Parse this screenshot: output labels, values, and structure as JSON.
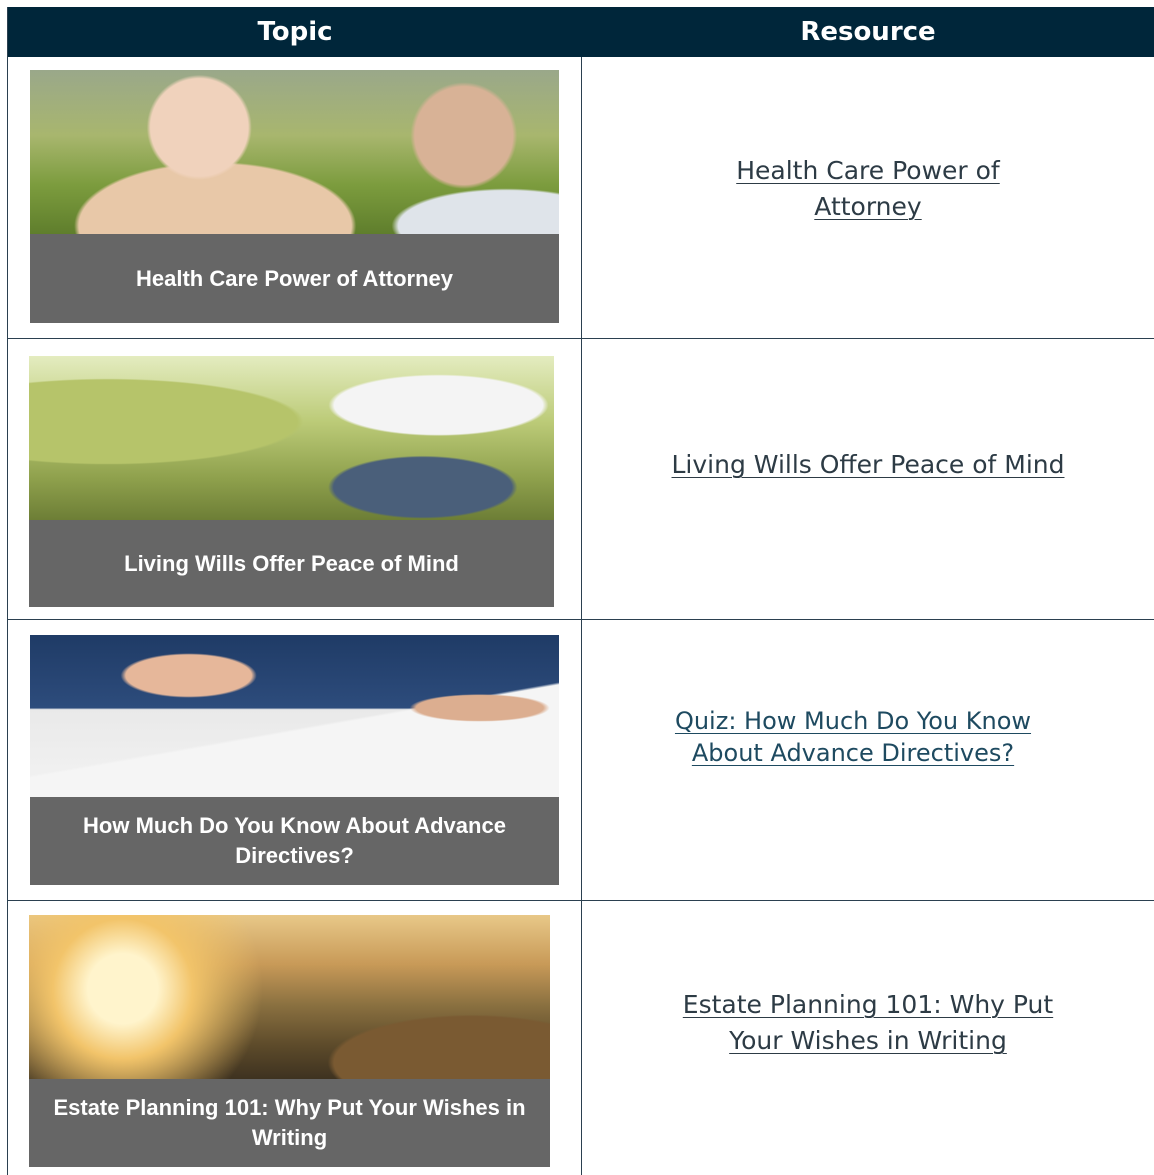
{
  "header": {
    "topic": "Topic",
    "resource": "Resource"
  },
  "rows": [
    {
      "caption": "Health Care Power of Attorney",
      "link": "Health Care Power of Attorney"
    },
    {
      "caption": "Living Wills Offer Peace of Mind",
      "link": "Living Wills Offer Peace of Mind"
    },
    {
      "caption": "How Much Do You Know About Advance Directives?",
      "link": "Quiz: How Much Do You Know About Advance Directives?"
    },
    {
      "caption": "Estate Planning 101: Why Put Your Wishes in Writing",
      "link": "Estate Planning 101: Why Put Your Wishes in Writing"
    }
  ],
  "colors": {
    "header_bg": "#00263a",
    "caption_bg": "#666666",
    "link": "#2d3b45"
  }
}
